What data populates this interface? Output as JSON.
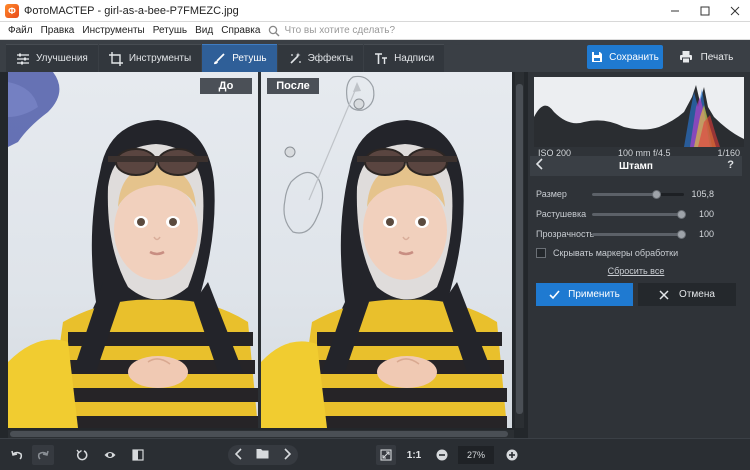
{
  "window": {
    "title": "ФотоМАСТЕР - girl-as-a-bee-P7FMEZC.jpg",
    "app_icon": "fotomaster-logo-icon"
  },
  "menu": {
    "items": [
      "Файл",
      "Правка",
      "Инструменты",
      "Ретушь",
      "Вид",
      "Справка"
    ],
    "search_placeholder": "Что вы хотите сделать?"
  },
  "toolbar": {
    "tabs": [
      {
        "label": "Улучшения",
        "icon": "sliders-icon",
        "active": false
      },
      {
        "label": "Инструменты",
        "icon": "crop-icon",
        "active": false
      },
      {
        "label": "Ретушь",
        "icon": "brush-icon",
        "active": true
      },
      {
        "label": "Эффекты",
        "icon": "magic-wand-icon",
        "active": false
      },
      {
        "label": "Надписи",
        "icon": "text-icon",
        "active": false
      }
    ],
    "save_label": "Сохранить",
    "print_label": "Печать",
    "accent": "#1f7ad1"
  },
  "canvas": {
    "before_label": "До",
    "after_label": "После"
  },
  "histogram": {
    "iso": "ISO 200",
    "lens": "100 mm f/4.5",
    "shutter": "1/160"
  },
  "panel": {
    "title": "Штамп",
    "sliders": [
      {
        "label": "Размер",
        "value": "105,8",
        "fraction": 0.7
      },
      {
        "label": "Растушевка",
        "value": "100",
        "fraction": 0.97
      },
      {
        "label": "Прозрачность",
        "value": "100",
        "fraction": 0.97
      }
    ],
    "checkbox_label": "Скрывать маркеры обработки",
    "checkbox_checked": false,
    "reset_label": "Сбросить все",
    "apply_label": "Применить",
    "cancel_label": "Отмена"
  },
  "bottom": {
    "ratio_label": "1:1",
    "zoom_value": "27%"
  }
}
